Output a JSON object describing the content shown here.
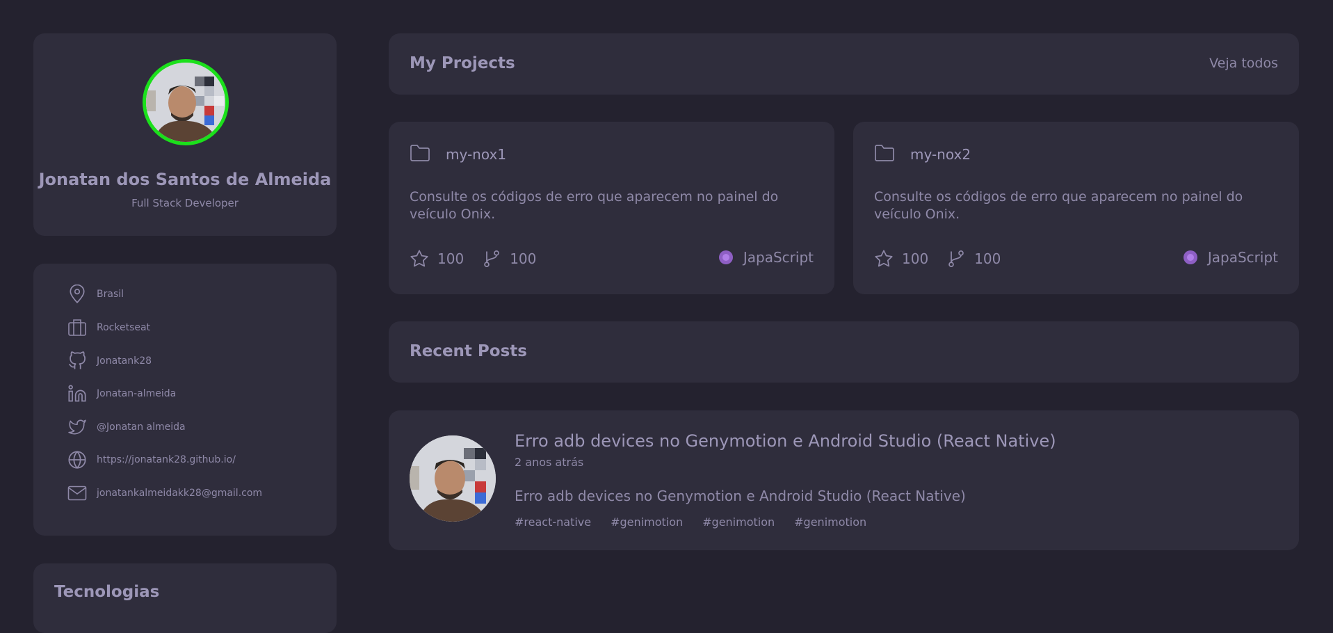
{
  "profile": {
    "name": "Jonatan dos Santos de Almeida",
    "role": "Full Stack Developer"
  },
  "info": {
    "location": "Brasil",
    "company": "Rocketseat",
    "github": "Jonatank28",
    "linkedin": "Jonatan-almeida",
    "twitter": "@Jonatan almeida",
    "website": "https://jonatank28.github.io/",
    "email": "jonatankalmeidakk28@gmail.com",
    "icons": [
      "map-pin-icon",
      "briefcase-icon",
      "github-icon",
      "linkedin-icon",
      "twitter-icon",
      "globe-icon",
      "mail-icon"
    ]
  },
  "technologies": {
    "title": "Tecnologias"
  },
  "projects": {
    "title": "My Projects",
    "see_all": "Veja todos",
    "items": [
      {
        "name": "my-nox1",
        "description": "Consulte os códigos de erro que aparecem no painel do veículo Onix.",
        "stars": "100",
        "forks": "100",
        "language": "JapaScript"
      },
      {
        "name": "my-nox2",
        "description": "Consulte os códigos de erro que aparecem no painel do veículo Onix.",
        "stars": "100",
        "forks": "100",
        "language": "JapaScript"
      }
    ]
  },
  "posts": {
    "title": "Recent Posts",
    "items": [
      {
        "title": "Erro adb devices no Genymotion e Android Studio (React Native)",
        "date": "2 anos atrás",
        "excerpt": "Erro adb devices no Genymotion e Android Studio (React Native)",
        "tags": [
          "#react-native",
          "#genimotion",
          "#genimotion",
          "#genimotion"
        ]
      }
    ]
  },
  "colors": {
    "background": "#24222f",
    "card": "#2f2d3c",
    "text": "#8f89a8",
    "avatar_ring": "#1be01b",
    "language_dot": "#8e5fc4"
  }
}
